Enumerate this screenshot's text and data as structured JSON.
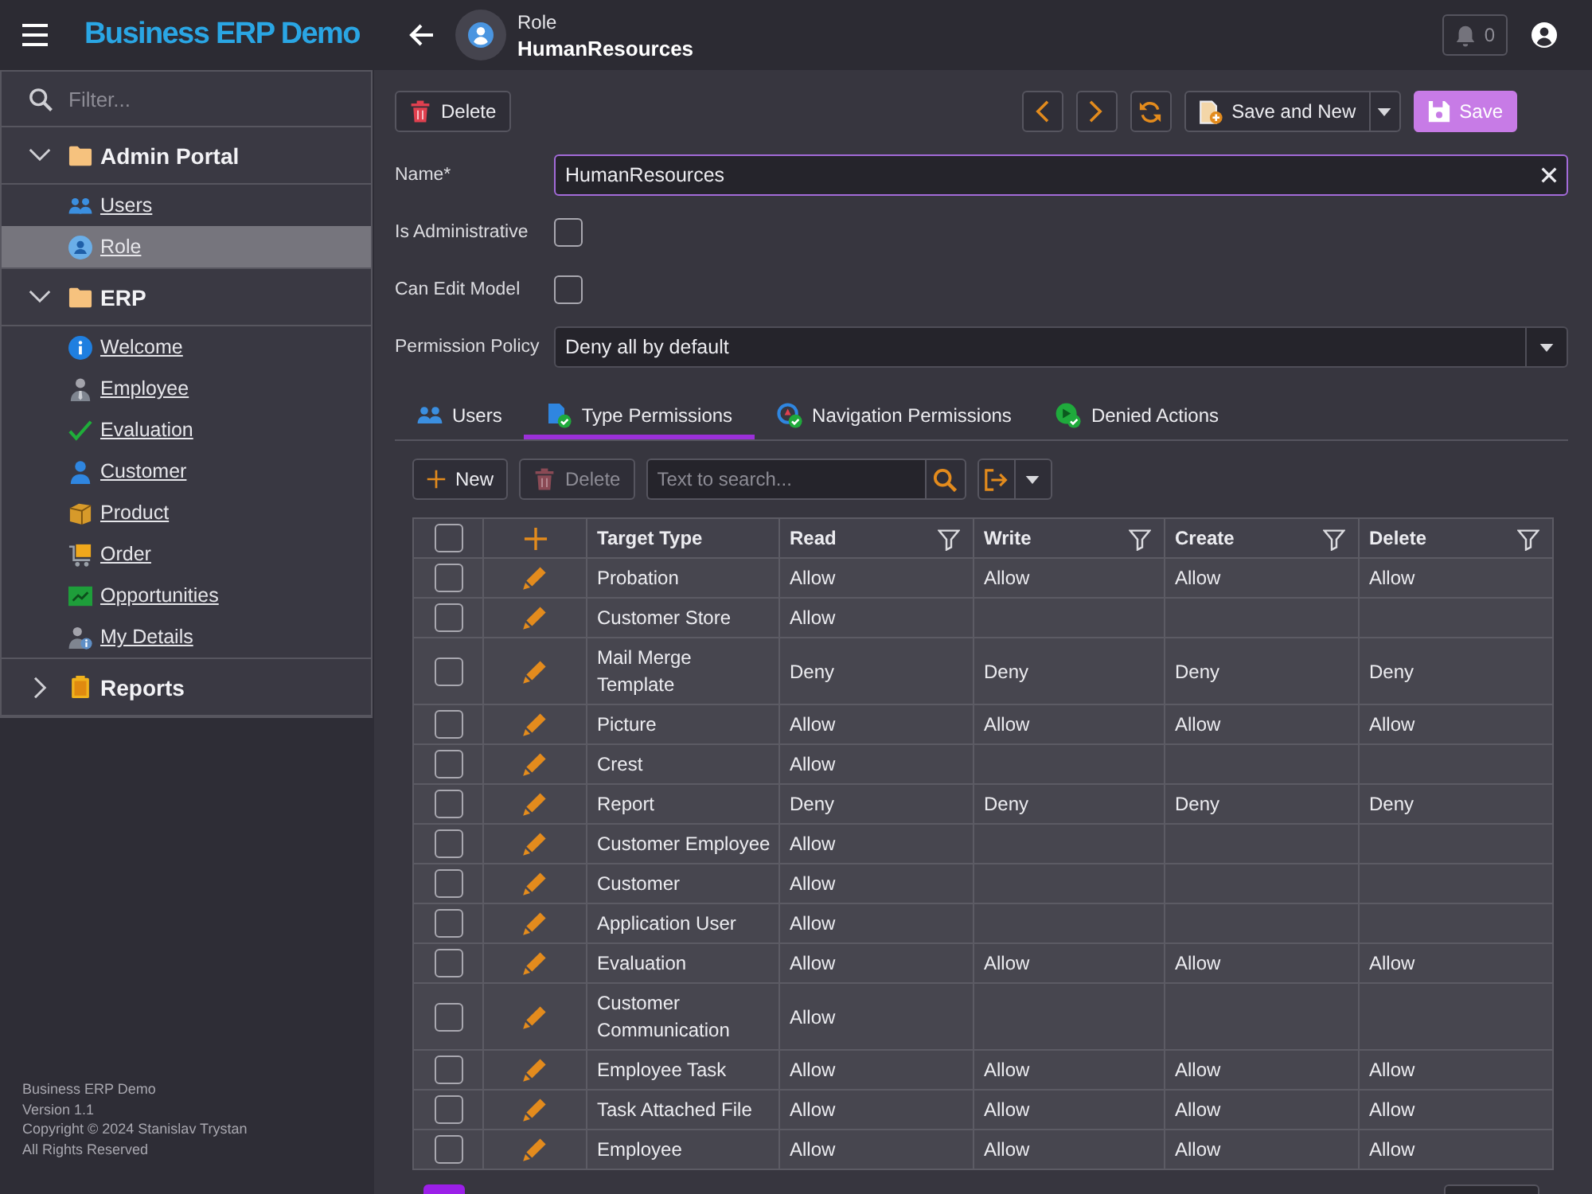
{
  "top_bar": {
    "app_title": "Business ERP Demo",
    "caption": "Role",
    "title": "HumanResources",
    "notification_count": "0"
  },
  "sidebar": {
    "filter_placeholder": "Filter...",
    "groups": [
      {
        "label": "Admin Portal",
        "kind": "folder",
        "expanded": true,
        "items": [
          {
            "label": "Users",
            "kind": "users",
            "selected": false
          },
          {
            "label": "Role",
            "kind": "role",
            "selected": true
          }
        ]
      },
      {
        "label": "ERP",
        "kind": "folder",
        "expanded": true,
        "items": [
          {
            "label": "Welcome",
            "kind": "info",
            "selected": false
          },
          {
            "label": "Employee",
            "kind": "employee",
            "selected": false
          },
          {
            "label": "Evaluation",
            "kind": "check",
            "selected": false
          },
          {
            "label": "Customer",
            "kind": "customer",
            "selected": false
          },
          {
            "label": "Product",
            "kind": "product",
            "selected": false
          },
          {
            "label": "Order",
            "kind": "order",
            "selected": false
          },
          {
            "label": "Opportunities",
            "kind": "chart",
            "selected": false
          },
          {
            "label": "My Details",
            "kind": "details",
            "selected": false
          }
        ]
      },
      {
        "label": "Reports",
        "kind": "report",
        "expanded": false
      }
    ],
    "footer": [
      "Business ERP Demo",
      "Version 1.1",
      "Copyright © 2024 Stanislav Trystan",
      "All Rights Reserved"
    ]
  },
  "toolbar": {
    "left": [
      {
        "kind": "delete",
        "label": "Delete"
      }
    ],
    "right": [
      {
        "kind": "previous"
      },
      {
        "kind": "next"
      },
      {
        "kind": "refresh"
      },
      {
        "kind": "savenew",
        "label": "Save and New"
      },
      {
        "kind": "save",
        "label": "Save"
      }
    ]
  },
  "form": {
    "fields": [
      {
        "kind": "text",
        "label": "Name*",
        "value": "HumanResources",
        "focused": true
      },
      {
        "kind": "checkbox",
        "label": "Is Administrative",
        "checked": false,
        "focused": false
      },
      {
        "kind": "checkbox",
        "label": "Can Edit Model",
        "checked": false,
        "focused": false
      },
      {
        "kind": "select",
        "label": "Permission Policy",
        "value": "Deny all by default",
        "focused": false
      }
    ]
  },
  "tabs": [
    {
      "label": "Users",
      "kind": "users",
      "selected": false
    },
    {
      "label": "Type Permissions",
      "kind": "types",
      "selected": true
    },
    {
      "label": "Navigation Permissions",
      "kind": "navigation",
      "selected": false
    },
    {
      "label": "Denied Actions",
      "kind": "actions",
      "selected": false
    }
  ],
  "grid_toolbar": {
    "buttons": [
      {
        "kind": "new",
        "label": "New",
        "disabled": false
      },
      {
        "kind": "delete",
        "label": "Delete",
        "disabled": true
      }
    ],
    "search_placeholder": "Text to search..."
  },
  "table": {
    "all_checked": false,
    "columns": [
      {
        "label": "Target Type",
        "filter": false
      },
      {
        "label": "Read",
        "filter": true
      },
      {
        "label": "Write",
        "filter": true
      },
      {
        "label": "Create",
        "filter": true
      },
      {
        "label": "Delete",
        "filter": true
      }
    ],
    "rows": [
      {
        "checked": false,
        "target_type": "Probation",
        "read": "Allow",
        "write": "Allow",
        "create": "Allow",
        "delete": "Allow"
      },
      {
        "checked": false,
        "target_type": "Customer Store",
        "read": "Allow"
      },
      {
        "checked": false,
        "target_type": "Mail Merge Template",
        "read": "Deny",
        "write": "Deny",
        "create": "Deny",
        "delete": "Deny"
      },
      {
        "checked": false,
        "target_type": "Picture",
        "read": "Allow",
        "write": "Allow",
        "create": "Allow",
        "delete": "Allow"
      },
      {
        "checked": false,
        "target_type": "Crest",
        "read": "Allow"
      },
      {
        "checked": false,
        "target_type": "Report",
        "read": "Deny",
        "write": "Deny",
        "create": "Deny",
        "delete": "Deny"
      },
      {
        "checked": false,
        "target_type": "Customer Employee",
        "read": "Allow"
      },
      {
        "checked": false,
        "target_type": "Customer",
        "read": "Allow"
      },
      {
        "checked": false,
        "target_type": "Application User",
        "read": "Allow"
      },
      {
        "checked": false,
        "target_type": "Evaluation",
        "read": "Allow",
        "write": "Allow",
        "create": "Allow",
        "delete": "Allow"
      },
      {
        "checked": false,
        "target_type": "Customer Communication",
        "read": "Allow"
      },
      {
        "checked": false,
        "target_type": "Employee Task",
        "read": "Allow",
        "write": "Allow",
        "create": "Allow",
        "delete": "Allow"
      },
      {
        "checked": false,
        "target_type": "Task Attached File",
        "read": "Allow",
        "write": "Allow",
        "create": "Allow",
        "delete": "Allow"
      },
      {
        "checked": false,
        "target_type": "Employee",
        "read": "Allow",
        "write": "Allow",
        "create": "Allow",
        "delete": "Allow"
      }
    ]
  },
  "pager": {
    "pages": [
      {
        "selected": true
      }
    ]
  }
}
